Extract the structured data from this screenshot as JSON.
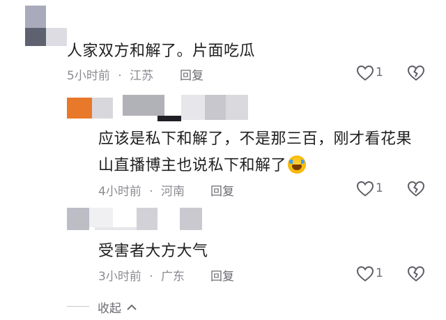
{
  "comments": [
    {
      "text": "人家双方和解了。片面吃瓜",
      "time": "5小时前",
      "location": "江苏",
      "reply_label": "回复",
      "like_count": "1"
    },
    {
      "text_line1": "应该是私下和解了，不是那三百，刚才看花果",
      "text_line2": "山直播博主也说私下和解了",
      "emoji": "crying-laughing",
      "time": "4小时前",
      "location": "河南",
      "reply_label": "回复",
      "like_count": "1"
    },
    {
      "text": "受害者大方大气",
      "time": "3小时前",
      "location": "广东",
      "reply_label": "回复",
      "like_count": "1"
    }
  ],
  "dot": "·",
  "collapse_label": "收起",
  "icons": {
    "like": "heart-icon",
    "dislike": "broken-heart-icon",
    "collapse": "chevron-up-icon"
  },
  "colors": {
    "text": "#1f1f1f",
    "meta": "#8a8b91",
    "avatar_orange": "#e8782a"
  }
}
